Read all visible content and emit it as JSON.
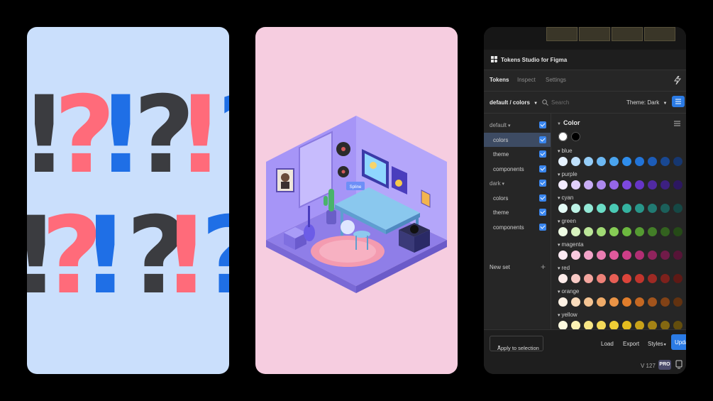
{
  "card1": {
    "glyphs": [
      {
        "char": "!",
        "color": "dark"
      },
      {
        "char": "?",
        "color": "pink"
      },
      {
        "char": "!",
        "color": "blue"
      },
      {
        "char": "?",
        "color": "dark"
      },
      {
        "char": "!",
        "color": "pink"
      },
      {
        "char": "?",
        "color": "blue"
      },
      {
        "char": "!",
        "color": "dark"
      },
      {
        "char": "?",
        "color": "pink"
      },
      {
        "char": "!",
        "color": "blue"
      },
      {
        "char": "?",
        "color": "dark"
      },
      {
        "char": "!",
        "color": "pink"
      },
      {
        "char": "?",
        "color": "blue"
      }
    ],
    "colors": {
      "dark": "#3b3c40",
      "pink": "#ff6b7a",
      "blue": "#1f6fe6",
      "background": "#cadffc"
    }
  },
  "card2": {
    "screen_label": "Spline",
    "colors": {
      "background": "#f6cde0",
      "room": "#9c8cf2",
      "rug": "#f49bb0"
    }
  },
  "plugin": {
    "title": "Tokens Studio for Figma",
    "tabs": [
      {
        "label": "Tokens",
        "active": true
      },
      {
        "label": "Inspect",
        "active": false
      },
      {
        "label": "Settings",
        "active": false
      }
    ],
    "set_selector": "default / colors",
    "search_placeholder": "Search",
    "theme_label": "Theme: Dark",
    "sets": [
      {
        "label": "default",
        "level": 0,
        "expandable": true,
        "checked": true,
        "active": false
      },
      {
        "label": "colors",
        "level": 1,
        "checked": true,
        "active": true
      },
      {
        "label": "theme",
        "level": 1,
        "checked": true,
        "active": false
      },
      {
        "label": "components",
        "level": 1,
        "checked": true,
        "active": false
      },
      {
        "label": "dark",
        "level": 0,
        "expandable": true,
        "checked": true,
        "active": false
      },
      {
        "label": "colors",
        "level": 1,
        "checked": true,
        "active": false
      },
      {
        "label": "theme",
        "level": 1,
        "checked": true,
        "active": false
      },
      {
        "label": "components",
        "level": 1,
        "checked": true,
        "active": false
      }
    ],
    "new_set_label": "New set",
    "color_heading": "Color",
    "base_swatches": [
      "#ffffff",
      "#000000"
    ],
    "groups": [
      {
        "label": "blue",
        "swatches": [
          "#e6f2ff",
          "#bfe0fb",
          "#95cdf7",
          "#6cb8f3",
          "#4aa4ee",
          "#2f8deb",
          "#2274d8",
          "#1c5cb8",
          "#194892",
          "#163770"
        ]
      },
      {
        "label": "purple",
        "swatches": [
          "#f3ecff",
          "#e1d0fb",
          "#c8acf5",
          "#ae89ee",
          "#9566e7",
          "#7d48de",
          "#6635c7",
          "#512aa3",
          "#3d2081",
          "#2c1760"
        ]
      },
      {
        "label": "cyan",
        "swatches": [
          "#e4fbf6",
          "#bdf3e6",
          "#93e8d6",
          "#6bdcc6",
          "#4ac9b4",
          "#34b2a0",
          "#28968a",
          "#217a72",
          "#1b5f5a",
          "#154845"
        ]
      },
      {
        "label": "green",
        "swatches": [
          "#eefbe4",
          "#d7f2bf",
          "#bce699",
          "#a0da74",
          "#86cc55",
          "#6cb73f",
          "#559b32",
          "#437e28",
          "#33621f",
          "#254a17"
        ]
      },
      {
        "label": "magenta",
        "swatches": [
          "#fdebf3",
          "#f8c9df",
          "#f2a3c8",
          "#ea7db1",
          "#e05a9c",
          "#cf3e88",
          "#b12e73",
          "#90245d",
          "#711b49",
          "#561437"
        ]
      },
      {
        "label": "red",
        "swatches": [
          "#fdecea",
          "#f9cbc6",
          "#f4a69f",
          "#ee8178",
          "#e75f55",
          "#dc443a",
          "#c1352d",
          "#9e2a24",
          "#7d211c",
          "#5e1915"
        ]
      },
      {
        "label": "orange",
        "swatches": [
          "#fdf1e4",
          "#f9dcbd",
          "#f4c493",
          "#efab69",
          "#ea9446",
          "#e07d2b",
          "#c56822",
          "#a2541c",
          "#814216",
          "#623210"
        ]
      },
      {
        "label": "yellow",
        "swatches": [
          "#fefae0",
          "#fbf1b4",
          "#f8e686",
          "#f4da59",
          "#efcd36",
          "#e4bc1f",
          "#c9a219",
          "#a58315",
          "#846811",
          "#644e0d"
        ]
      }
    ],
    "footer": {
      "apply_label": "Apply to selection",
      "load_label": "Load",
      "export_label": "Export",
      "styles_label": "Styles",
      "update_label": "Upda",
      "version": "V 127",
      "plan_badge": "PRO"
    },
    "colors": {
      "accent": "#2b7be5",
      "panel": "#262626",
      "active_row": "#3d4b63"
    }
  }
}
